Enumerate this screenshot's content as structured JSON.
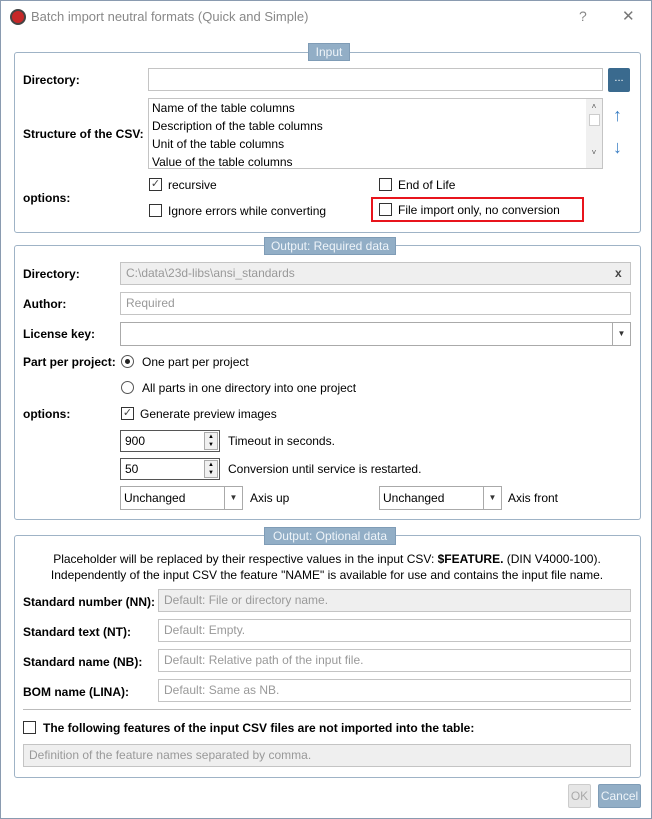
{
  "window": {
    "title": "Batch import neutral formats (Quick and Simple)",
    "help": "?",
    "close": "✕"
  },
  "input": {
    "legend": "Input",
    "directory_label": "Directory:",
    "directory_value": "",
    "browse": "...",
    "structure_label": "Structure of the CSV:",
    "structure_items": [
      "Name of the table columns",
      "Description of the table columns",
      "Unit of the table columns",
      "Value of the table columns"
    ],
    "options_label": "options:",
    "recursive": "recursive",
    "recursive_checked": true,
    "end_of_life": "End of Life",
    "ignore_errors": "Ignore errors while converting",
    "file_import_only": "File import only, no conversion",
    "highlight_color": "#e8141c"
  },
  "required": {
    "legend": "Output: Required data",
    "directory_label": "Directory:",
    "directory_value": "C:\\data\\23d-libs\\ansi_standards",
    "clear": "x",
    "author_label": "Author:",
    "author_placeholder": "Required",
    "license_label": "License key:",
    "license_value": "",
    "part_label": "Part per project:",
    "radio_one": "One part per project",
    "radio_all": "All parts in one directory into one project",
    "options_label": "options:",
    "preview": "Generate preview images",
    "timeout_value": "900",
    "timeout_label": "Timeout in seconds.",
    "restart_value": "50",
    "restart_label": "Conversion until service is restarted.",
    "axis_up_value": "Unchanged",
    "axis_up_label": "Axis up",
    "axis_front_value": "Unchanged",
    "axis_front_label": "Axis front"
  },
  "optional": {
    "legend": "Output: Optional data",
    "info1_a": "Placeholder will be replaced by their respective values in the input CSV: ",
    "info1_b": "$FEATURE.",
    "info1_c": " (DIN V4000-100).",
    "info2": "Independently of the input CSV the feature \"NAME\" is available for use and contains the input file name.",
    "nn_label": "Standard number (NN):",
    "nn_placeholder": "Default: File or directory name.",
    "nt_label": "Standard text (NT):",
    "nt_placeholder": "Default: Empty.",
    "nb_label": "Standard name (NB):",
    "nb_placeholder": "Default: Relative path of the input file.",
    "lina_label": "BOM name (LINA):",
    "lina_placeholder": "Default: Same as NB.",
    "exclude_label": "The following features of the input CSV files are not imported into the table:",
    "exclude_placeholder": "Definition of the feature names separated by comma."
  },
  "footer": {
    "ok": "OK",
    "cancel": "Cancel"
  }
}
